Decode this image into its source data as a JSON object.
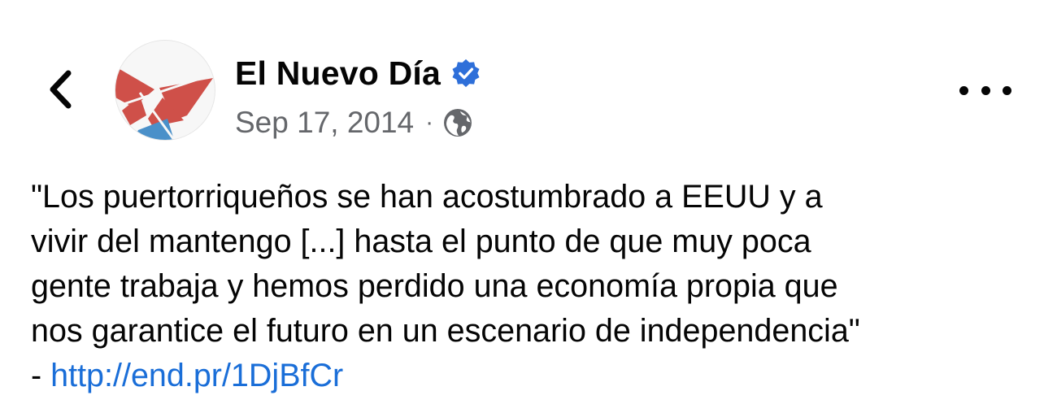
{
  "header": {
    "page_name": "El Nuevo Día",
    "date": "Sep 17, 2014",
    "separator": "·",
    "back_icon": "chevron-left-icon",
    "verified_icon": "verified-badge-icon",
    "privacy_icon": "globe-icon",
    "more_icon": "more-horizontal-icon"
  },
  "post": {
    "lines": [
      "\"Los puertorriqueños se han acostumbrado a EEUU y a",
      "vivir del mantengo [...] hasta el punto de que muy poca",
      "gente trabaja y hemos perdido una economía propia que",
      "nos garantice el futuro en un escenario de independencia\""
    ],
    "link_prefix": "- ",
    "link_text": "http://end.pr/1DjBfCr"
  },
  "colors": {
    "text": "#050505",
    "secondary_text": "#65676b",
    "link": "#1a6ed8",
    "verified_blue": "#2e6fd9",
    "logo_red": "#cf5049",
    "logo_blue": "#4a90c9"
  }
}
